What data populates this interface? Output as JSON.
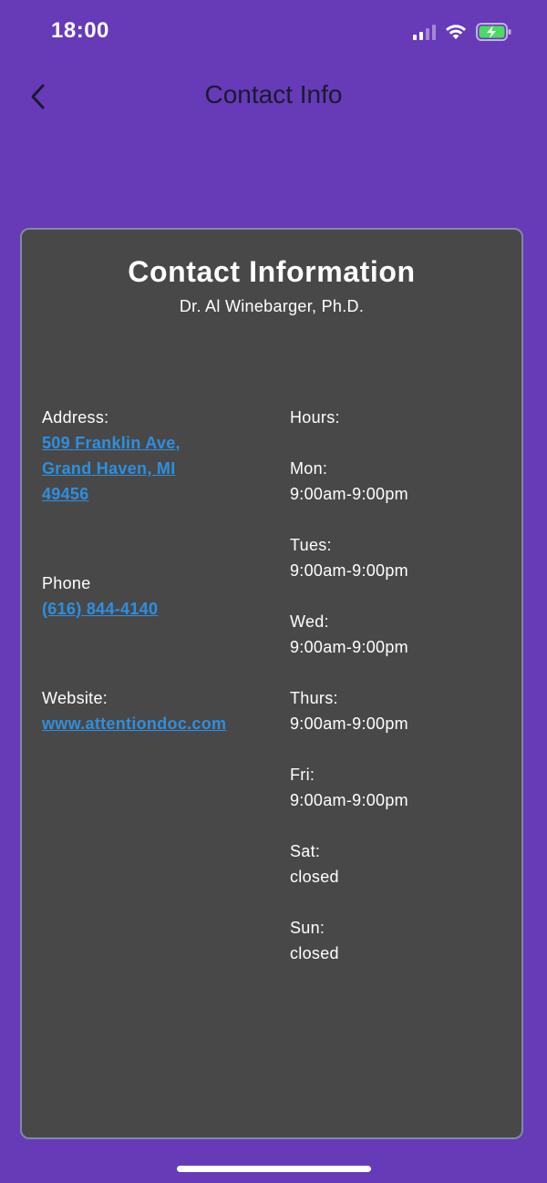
{
  "status_bar": {
    "time": "18:00",
    "icons": [
      "signal-icon",
      "wifi-icon",
      "battery-charging-icon"
    ]
  },
  "app_bar": {
    "title": "Contact Info",
    "back_icon": "chevron-left-icon"
  },
  "card": {
    "title": "Contact Information",
    "subtitle": "Dr. Al Winebarger, Ph.D.",
    "address": {
      "label": "Address:",
      "lines": [
        "509 Franklin Ave,",
        "Grand Haven, MI",
        "49456"
      ]
    },
    "phone": {
      "label": "Phone",
      "value": "(616) 844-4140"
    },
    "website": {
      "label": "Website:",
      "value": "www.attentiondoc.com"
    },
    "hours": {
      "label": "Hours:",
      "days": [
        {
          "day": "Mon:",
          "time": "9:00am-9:00pm"
        },
        {
          "day": "Tues:",
          "time": "9:00am-9:00pm"
        },
        {
          "day": "Wed:",
          "time": "9:00am-9:00pm"
        },
        {
          "day": "Thurs:",
          "time": "9:00am-9:00pm"
        },
        {
          "day": "Fri:",
          "time": "9:00am-9:00pm"
        },
        {
          "day": "Sat:",
          "time": "closed"
        },
        {
          "day": "Sun:",
          "time": "closed"
        }
      ]
    }
  },
  "colors": {
    "background": "#673ab7",
    "card": "#484848",
    "card_border": "#7e8aa6",
    "link": "#2e8fe0",
    "battery": "#4cd964"
  }
}
